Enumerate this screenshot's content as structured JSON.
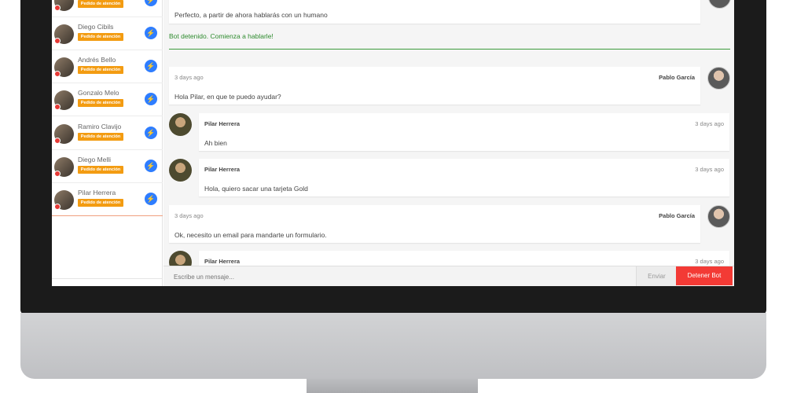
{
  "sidebar": {
    "contacts": [
      {
        "name": "",
        "badge": "Pedido de atención",
        "channel_icon": "messenger-icon"
      },
      {
        "name": "Diego Cibils",
        "badge": "Pedido de atención",
        "channel_icon": "messenger-icon"
      },
      {
        "name": "Andrés Bello",
        "badge": "Pedido de atención",
        "channel_icon": "messenger-icon"
      },
      {
        "name": "Gonzalo Melo",
        "badge": "Pedido de atención",
        "channel_icon": "messenger-icon"
      },
      {
        "name": "Ramiro Clavijo",
        "badge": "Pedido de atención",
        "channel_icon": "messenger-icon"
      },
      {
        "name": "Diego Melli",
        "badge": "Pedido de atención",
        "channel_icon": "messenger-icon"
      },
      {
        "name": "Pilar Herrera",
        "badge": "Pedido de atención",
        "channel_icon": "messenger-icon"
      }
    ]
  },
  "chat": {
    "top_message": "Perfecto, a partir de ahora hablarás con un humano",
    "bot_stopped_notice": "Bot detenido. Comienza a hablarle!",
    "messages": [
      {
        "role": "agent",
        "time": "3 days ago",
        "author": "Pablo García",
        "text": "Hola Pilar, en que te puedo ayudar?"
      },
      {
        "role": "customer",
        "time": "3 days ago",
        "author": "Pilar Herrera",
        "text": "Ah bien"
      },
      {
        "role": "customer",
        "time": "3 days ago",
        "author": "Pilar Herrera",
        "text": "Hola, quiero sacar una tarjeta Gold"
      },
      {
        "role": "agent",
        "time": "3 days ago",
        "author": "Pablo García",
        "text": "Ok, necesito un email para mandarte un formulario."
      },
      {
        "role": "customer",
        "time": "3 days ago",
        "author": "Pilar Herrera",
        "text": ""
      }
    ]
  },
  "composer": {
    "placeholder": "Escribe un mensaje...",
    "value": "",
    "send_label": "Enviar",
    "stop_bot_label": "Detener Bot"
  },
  "colors": {
    "badge": "#f39c12",
    "stop_button": "#f33a35",
    "bot_notice": "#2e8b2e",
    "messenger": "#2e7dff"
  }
}
